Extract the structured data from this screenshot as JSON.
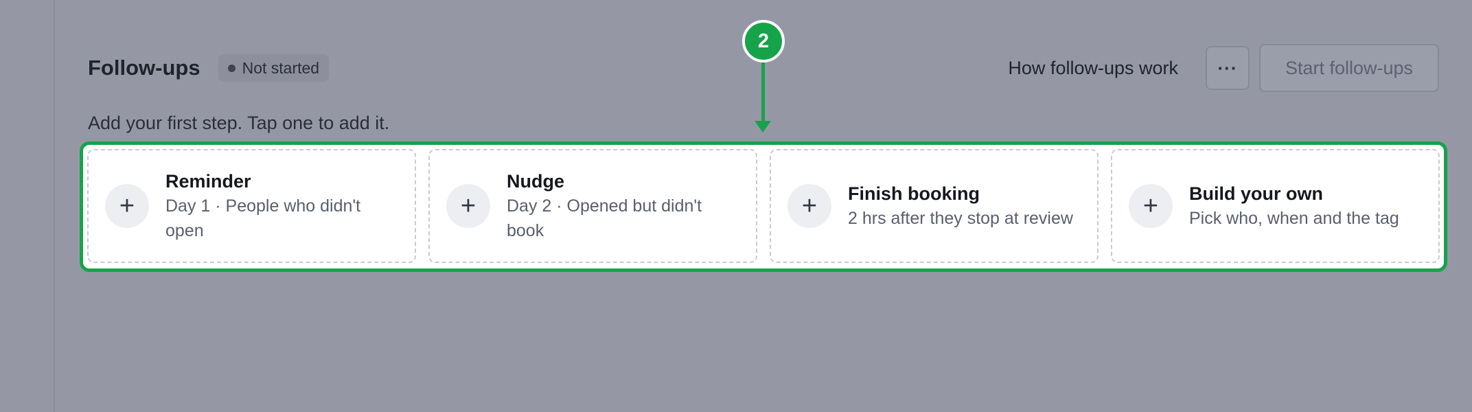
{
  "header": {
    "title": "Follow-ups",
    "status": "Not started",
    "help_link": "How follow-ups work",
    "more_label": "···",
    "start_button": "Start follow-ups"
  },
  "subtitle": "Add your first step. Tap one to add it.",
  "annotation": {
    "step_number": "2",
    "color": "#16a34a"
  },
  "cards": [
    {
      "title": "Reminder",
      "description": "Day 1 · People who didn't open",
      "icon": "plus-icon"
    },
    {
      "title": "Nudge",
      "description": "Day 2 · Opened but didn't book",
      "icon": "plus-icon"
    },
    {
      "title": "Finish booking",
      "description": "2 hrs after they stop at review",
      "icon": "plus-icon"
    },
    {
      "title": "Build your own",
      "description": "Pick who, when and the tag",
      "icon": "plus-icon"
    }
  ]
}
